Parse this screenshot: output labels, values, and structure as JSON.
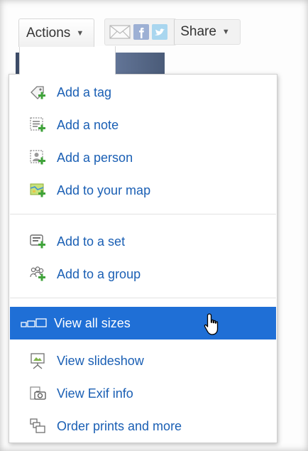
{
  "toolbar": {
    "actions_label": "Actions",
    "share_label": "Share",
    "icons": [
      "email-icon",
      "facebook-icon",
      "twitter-icon"
    ]
  },
  "menu": {
    "items": [
      {
        "label": "Add a tag",
        "icon": "add-tag-icon"
      },
      {
        "label": "Add a note",
        "icon": "add-note-icon"
      },
      {
        "label": "Add a person",
        "icon": "add-person-icon"
      },
      {
        "label": "Add to your map",
        "icon": "add-to-map-icon"
      },
      {
        "label": "Add to a set",
        "icon": "add-to-set-icon"
      },
      {
        "label": "Add to a group",
        "icon": "add-to-group-icon"
      },
      {
        "label": "View all sizes",
        "icon": "view-sizes-icon",
        "highlighted": true
      },
      {
        "label": "View slideshow",
        "icon": "slideshow-icon"
      },
      {
        "label": "View Exif info",
        "icon": "exif-camera-icon"
      },
      {
        "label": "Order prints and more",
        "icon": "order-prints-icon"
      }
    ]
  },
  "colors": {
    "link": "#1a5fb4",
    "highlight": "#1f6fd6",
    "highlight_text": "#ffffff",
    "plus_green": "#3fa33a"
  }
}
